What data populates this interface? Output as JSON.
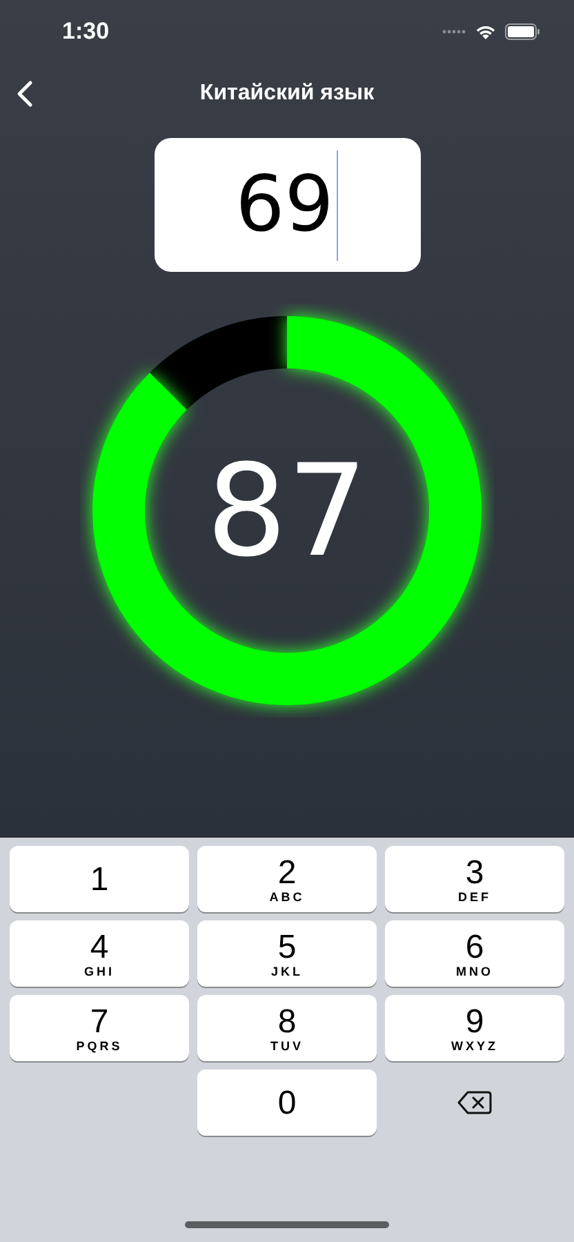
{
  "status_bar": {
    "time": "1:30"
  },
  "nav": {
    "title": "Китайский язык"
  },
  "input": {
    "value": "69"
  },
  "gauge": {
    "value": "87"
  },
  "keypad": {
    "keys": [
      {
        "kind": "digit",
        "digit": "1"
      },
      {
        "kind": "digit",
        "digit": "2",
        "letters": "ABC"
      },
      {
        "kind": "digit",
        "digit": "3",
        "letters": "DEF"
      },
      {
        "kind": "digit",
        "digit": "4",
        "letters": "GHI"
      },
      {
        "kind": "digit",
        "digit": "5",
        "letters": "JKL"
      },
      {
        "kind": "digit",
        "digit": "6",
        "letters": "MNO"
      },
      {
        "kind": "digit",
        "digit": "7",
        "letters": "PQRS"
      },
      {
        "kind": "digit",
        "digit": "8",
        "letters": "TUV"
      },
      {
        "kind": "digit",
        "digit": "9",
        "letters": "WXYZ"
      },
      {
        "kind": "blank"
      },
      {
        "kind": "digit",
        "digit": "0"
      },
      {
        "kind": "delete"
      }
    ]
  }
}
